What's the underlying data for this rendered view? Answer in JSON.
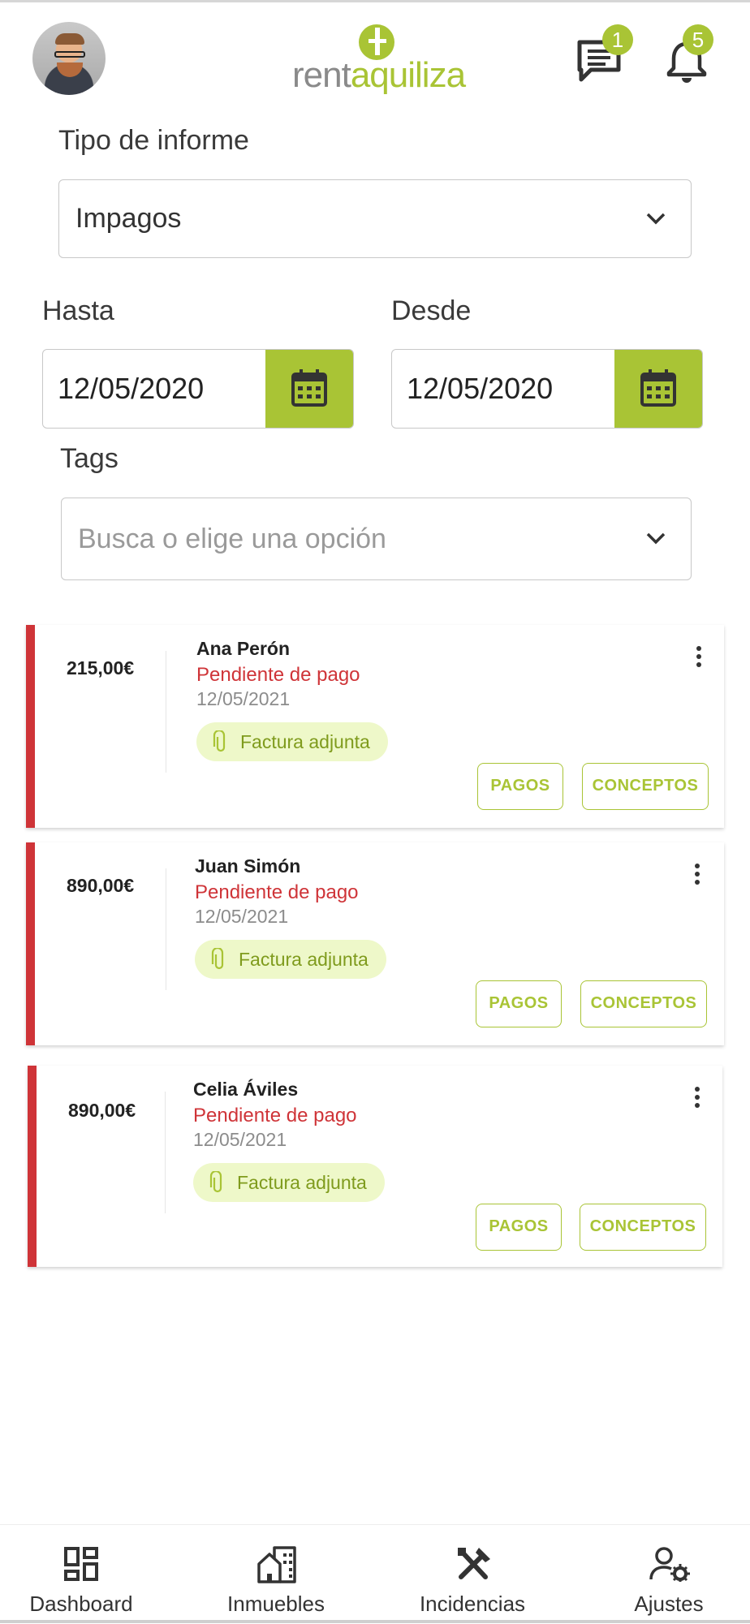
{
  "header": {
    "logo_left": "rent",
    "logo_right": "aquiliza",
    "messages_badge": "1",
    "notifications_badge": "5"
  },
  "filters": {
    "report_type_label": "Tipo de informe",
    "report_type_value": "Impagos",
    "hasta_label": "Hasta",
    "hasta_value": "12/05/2020",
    "desde_label": "Desde",
    "desde_value": "12/05/2020",
    "tags_label": "Tags",
    "tags_placeholder": "Busca o elige una opción"
  },
  "cards": [
    {
      "amount": "215,00€",
      "name": "Ana Perón",
      "status": "Pendiente de pago",
      "date": "12/05/2021",
      "attachment": "Factura adjunta",
      "pagos": "PAGOS",
      "conceptos": "CONCEPTOS"
    },
    {
      "amount": "890,00€",
      "name": "Juan Simón",
      "status": "Pendiente de pago",
      "date": "12/05/2021",
      "attachment": "Factura adjunta",
      "pagos": "PAGOS",
      "conceptos": "CONCEPTOS"
    },
    {
      "amount": "890,00€",
      "name": "Celia Áviles",
      "status": "Pendiente de pago",
      "date": "12/05/2021",
      "attachment": "Factura adjunta",
      "pagos": "PAGOS",
      "conceptos": "CONCEPTOS"
    }
  ],
  "nav": [
    {
      "label": "Dashboard",
      "icon": "dashboard-icon"
    },
    {
      "label": "Inmuebles",
      "icon": "building-icon"
    },
    {
      "label": "Incidencias",
      "icon": "tools-icon"
    },
    {
      "label": "Ajustes",
      "icon": "user-settings-icon"
    }
  ],
  "colors": {
    "accent": "#a9c435",
    "danger": "#cf3438",
    "chip_bg": "#eef8c9"
  }
}
